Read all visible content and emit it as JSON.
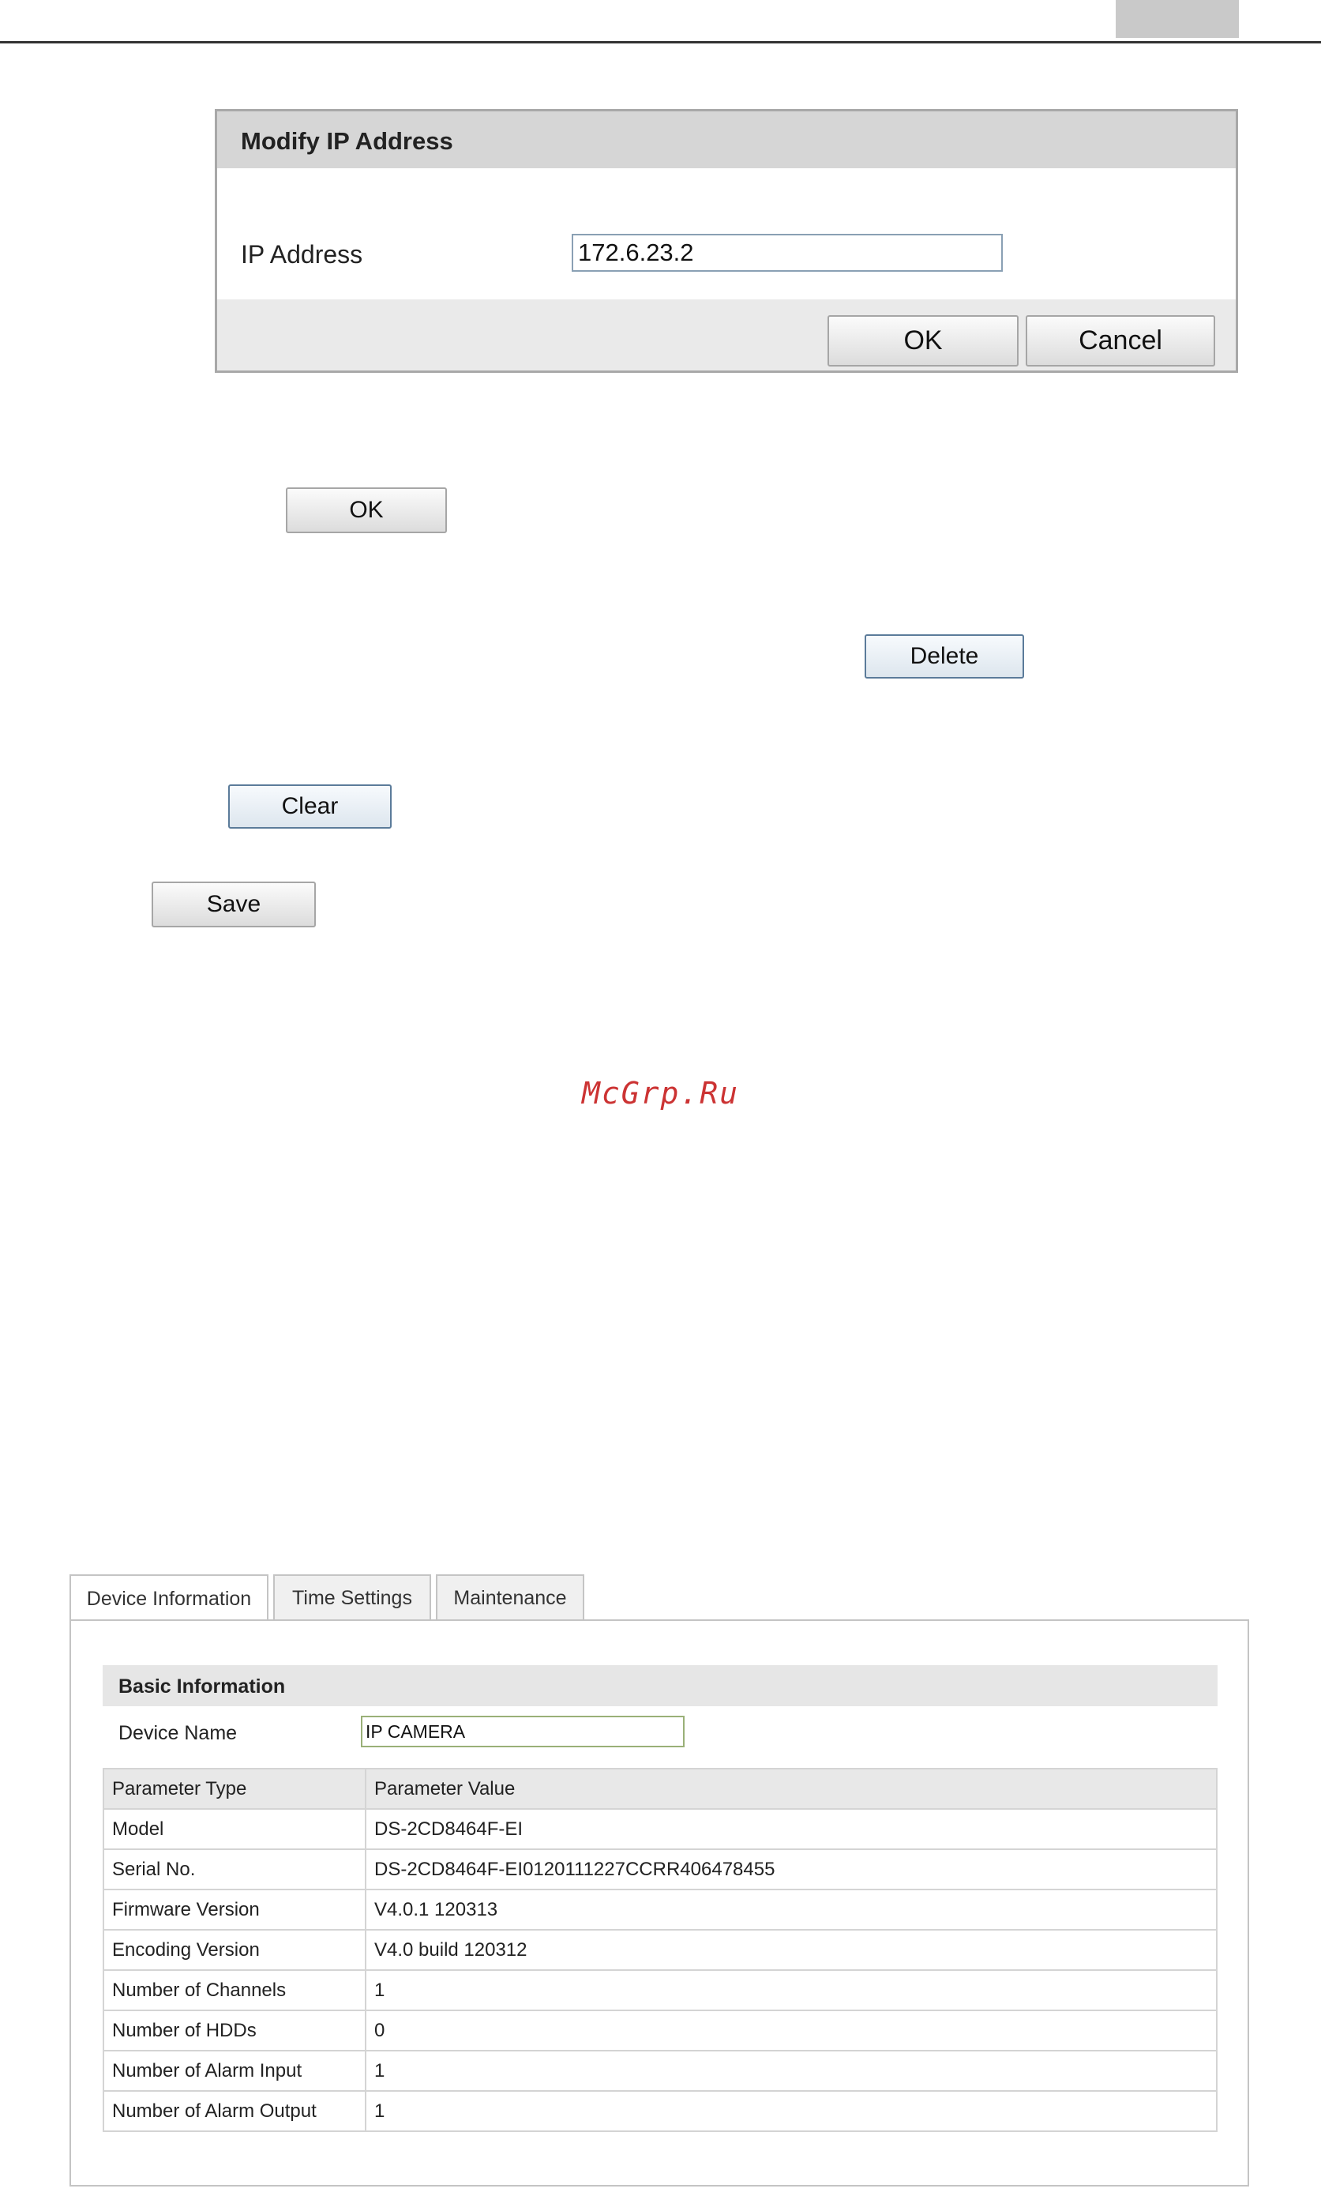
{
  "dialog": {
    "title": "Modify IP Address",
    "field_label": "IP Address",
    "ip_value": "172.6.23.2",
    "ok_label": "OK",
    "cancel_label": "Cancel"
  },
  "buttons": {
    "ok": "OK",
    "delete": "Delete",
    "clear": "Clear",
    "save": "Save"
  },
  "watermark": "McGrp.Ru",
  "device_panel": {
    "tabs": [
      {
        "label": "Device Information",
        "active": true
      },
      {
        "label": "Time Settings",
        "active": false
      },
      {
        "label": "Maintenance",
        "active": false
      }
    ],
    "section_title": "Basic Information",
    "device_name_label": "Device Name",
    "device_name_value": "IP CAMERA",
    "table": {
      "headers": [
        "Parameter Type",
        "Parameter Value"
      ],
      "rows": [
        [
          "Model",
          "DS-2CD8464F-EI"
        ],
        [
          "Serial No.",
          "DS-2CD8464F-EI0120111227CCRR406478455"
        ],
        [
          "Firmware Version",
          "V4.0.1 120313"
        ],
        [
          "Encoding Version",
          "V4.0 build 120312"
        ],
        [
          "Number of Channels",
          "1"
        ],
        [
          "Number of HDDs",
          "0"
        ],
        [
          "Number of Alarm Input",
          "1"
        ],
        [
          "Number of Alarm Output",
          "1"
        ]
      ]
    }
  }
}
